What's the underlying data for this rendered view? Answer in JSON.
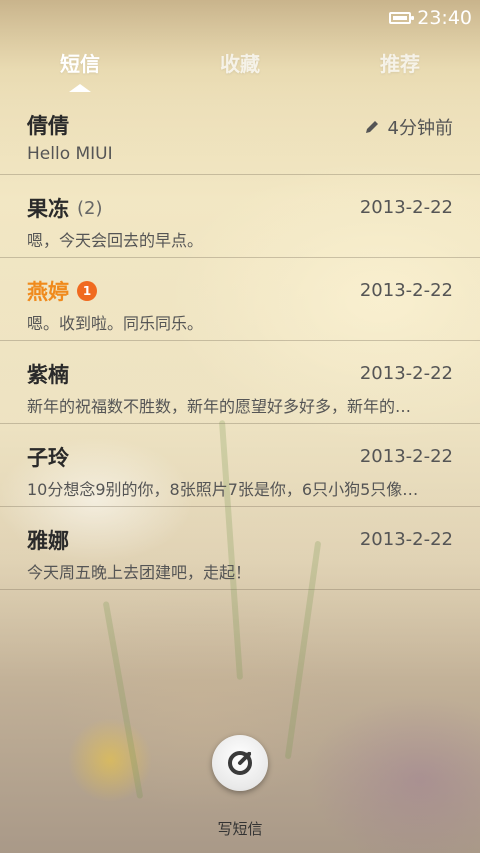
{
  "status_bar": {
    "time": "23:40",
    "battery_icon": "battery-icon"
  },
  "tabs": [
    {
      "label": "短信",
      "active": true
    },
    {
      "label": "收藏",
      "active": false
    },
    {
      "label": "推荐",
      "active": false
    }
  ],
  "conversations": [
    {
      "name": "倩倩",
      "count": "",
      "badge": "",
      "time": "4分钟前",
      "draft": true,
      "preview": "Hello MIUI",
      "unread": false
    },
    {
      "name": "果冻",
      "count": "(2)",
      "badge": "",
      "time": "2013-2-22",
      "draft": false,
      "preview": "嗯，今天会回去的早点。",
      "unread": false
    },
    {
      "name": "燕婷",
      "count": "",
      "badge": "1",
      "time": "2013-2-22",
      "draft": false,
      "preview": "嗯。收到啦。同乐同乐。",
      "unread": true
    },
    {
      "name": "紫楠",
      "count": "",
      "badge": "",
      "time": "2013-2-22",
      "draft": false,
      "preview": "新年的祝福数不胜数，新年的愿望好多好多，新年的…",
      "unread": false
    },
    {
      "name": "子玲",
      "count": "",
      "badge": "",
      "time": "2013-2-22",
      "draft": false,
      "preview": "10分想念9别的你，8张照片7张是你，6只小狗5只像…",
      "unread": false
    },
    {
      "name": "雅娜",
      "count": "",
      "badge": "",
      "time": "2013-2-22",
      "draft": false,
      "preview": "今天周五晚上去团建吧，走起！",
      "unread": false
    }
  ],
  "compose": {
    "label": "写短信",
    "icon": "compose-icon"
  },
  "colors": {
    "unread_name": "#f08a1c",
    "badge": "#f06a20"
  }
}
